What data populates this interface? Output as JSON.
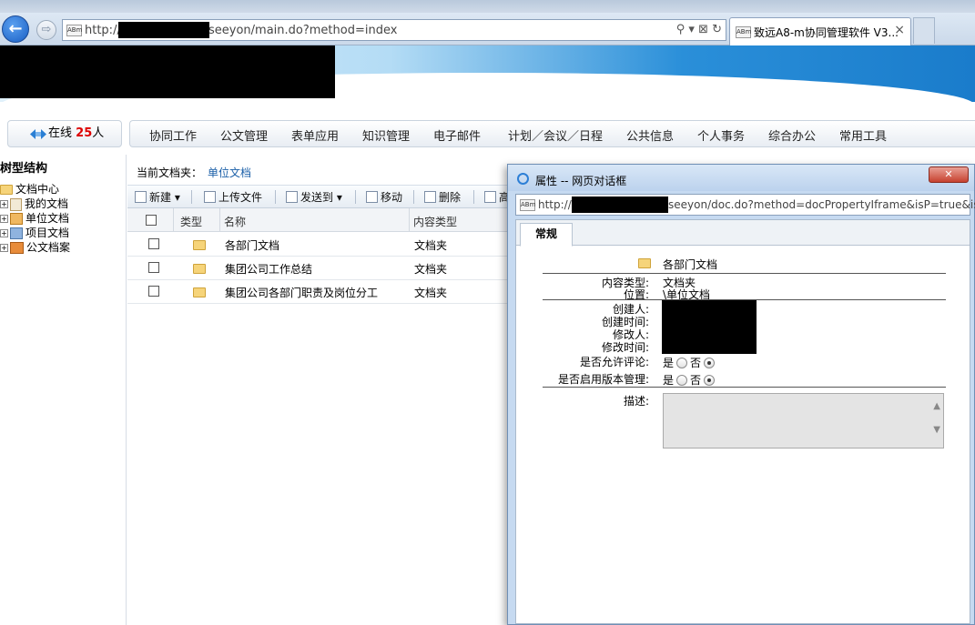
{
  "browser": {
    "url_prefix": "http://",
    "url_suffix": "seeyon/main.do?method=index",
    "tab_title": "致远A8-m协同管理软件 V3...",
    "tab_close": "×",
    "site_icon": "ABm",
    "back_icon": "←",
    "forward_icon": "⇨",
    "addr_tools": "⚲ ▾ ⊠ ↻"
  },
  "menubar": {
    "online_label": "在线",
    "online_count": "25",
    "online_unit": "人",
    "items": [
      "协同工作",
      "公文管理",
      "表单应用",
      "知识管理",
      "电子邮件",
      "计划／会议／日程",
      "公共信息",
      "个人事务",
      "综合办公",
      "常用工具"
    ]
  },
  "tree": {
    "header": "树型结构",
    "root": "文档中心",
    "nodes": [
      "我的文档",
      "单位文档",
      "项目文档",
      "公文档案"
    ]
  },
  "content": {
    "current_folder_label": "当前文档夹：",
    "current_folder_value": "单位文档",
    "toolbar": {
      "new": "新建",
      "upload": "上传文件",
      "send_to": "发送到",
      "move": "移动",
      "delete": "删除",
      "more": "高"
    },
    "columns": [
      "类型",
      "名称",
      "内容类型"
    ],
    "rows": [
      {
        "name": "各部门文档",
        "type": "文档夹"
      },
      {
        "name": "集团公司工作总结",
        "type": "文档夹"
      },
      {
        "name": "集团公司各部门职责及岗位分工",
        "type": "文档夹"
      }
    ]
  },
  "dialog": {
    "title": "属性 -- 网页对话框",
    "close_label": "✕",
    "url_prefix": "http://",
    "url_suffix": "seeyon/doc.do?method=docPropertyIframe&isP=true&is",
    "tab": "常规",
    "doc_name": "各部门文档",
    "labels": {
      "content_type": "内容类型:",
      "location": "位置:",
      "creator": "创建人:",
      "created_time": "创建时间:",
      "modifier": "修改人:",
      "modified_time": "修改时间:",
      "allow_comment": "是否允许评论:",
      "version_mgmt": "是否启用版本管理:",
      "description": "描述:"
    },
    "values": {
      "content_type": "文档夹",
      "location": "\\单位文档"
    },
    "yes": "是",
    "no": "否"
  },
  "colors": {
    "accent_blue": "#1a5fa8",
    "online_count_red": "#dd0000",
    "close_red": "#c7412f"
  }
}
